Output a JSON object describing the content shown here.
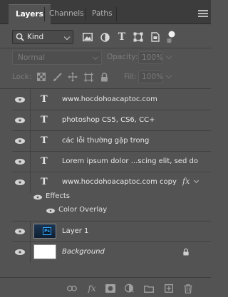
{
  "tabs": [
    {
      "label": "Layers",
      "active": true
    },
    {
      "label": "Channels",
      "active": false
    },
    {
      "label": "Paths",
      "active": false
    }
  ],
  "filter": {
    "kind_label": "Kind",
    "icons": [
      "pixel-filter-icon",
      "adjustment-filter-icon",
      "type-filter-icon",
      "shape-filter-icon",
      "smart-object-filter-icon",
      "filter-toggle-icon"
    ]
  },
  "blend": {
    "mode": "Normal",
    "opacity_label": "Opacity:",
    "opacity_value": "100%"
  },
  "lock": {
    "label": "Lock:",
    "icons": [
      "lock-transparent-icon",
      "lock-image-icon",
      "lock-position-icon",
      "lock-artboard-icon",
      "lock-all-icon"
    ],
    "fill_label": "Fill:",
    "fill_value": "100%"
  },
  "layers": [
    {
      "type": "text",
      "name": "www.hocdohoacaptoc.com",
      "italic": false
    },
    {
      "type": "text",
      "name": "photoshop CS5, CS6, CC+",
      "italic": false
    },
    {
      "type": "text",
      "name": "các lỗi thường gặp trong",
      "italic": false
    },
    {
      "type": "text",
      "name": "Lorem ipsum dolor ...scing elit, sed do",
      "italic": false
    },
    {
      "type": "text",
      "name": "www.hocdohoacaptoc.com copy",
      "italic": false,
      "has_effects": true,
      "effects_label": "Effects",
      "effects": [
        "Color Overlay"
      ]
    },
    {
      "type": "pixel",
      "name": "Layer 1",
      "thumb_label": "Ps"
    },
    {
      "type": "background",
      "name": "Background",
      "italic": true,
      "locked": true
    }
  ],
  "bottom_icons": [
    "link-layers-icon",
    "add-layer-style-icon",
    "add-mask-icon",
    "new-adjustment-layer-icon",
    "new-group-icon",
    "new-layer-icon",
    "delete-layer-icon"
  ],
  "colors": {
    "panel": "#535353",
    "tab_bar": "#3c3c3c",
    "ps_blue": "#31a8ff"
  }
}
